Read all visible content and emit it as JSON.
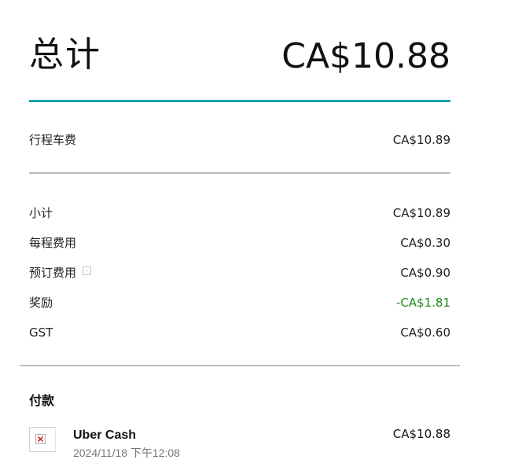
{
  "total": {
    "label": "总计",
    "amount": "CA$10.88"
  },
  "fare": {
    "label": "行程车费",
    "value": "CA$10.89"
  },
  "breakdown": [
    {
      "label": "小计",
      "value": "CA$10.89",
      "has_info": false,
      "negative": false
    },
    {
      "label": "每程费用",
      "value": "CA$0.30",
      "has_info": false,
      "negative": false
    },
    {
      "label": "预订费用",
      "value": "CA$0.90",
      "has_info": true,
      "negative": false
    },
    {
      "label": "奖励",
      "value": "-CA$1.81",
      "has_info": false,
      "negative": true
    },
    {
      "label": "GST",
      "value": "CA$0.60",
      "has_info": false,
      "negative": false
    }
  ],
  "payment": {
    "title": "付款",
    "method": "Uber Cash",
    "datetime": "2024/11/18 下午12:08",
    "amount": "CA$10.88",
    "icon": "broken-image-icon"
  },
  "colors": {
    "accent_rule": "#1a9fb2",
    "negative_value": "#1a8a1a",
    "divider": "#bdbdbd"
  }
}
